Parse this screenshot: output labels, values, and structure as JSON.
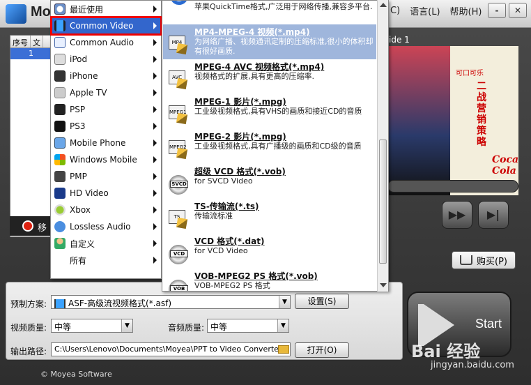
{
  "app": {
    "title": "Mo",
    "menu_about": "C)",
    "menu_language": "语言(L)",
    "menu_help": "帮助(H)",
    "btn_min": "-",
    "btn_close": "✕"
  },
  "list": {
    "col_seq": "序号",
    "col_file": "文",
    "row_seq": "1"
  },
  "preview": {
    "slide_label": "ide 1",
    "brand": "可口可乐",
    "slogan": "二战营销策略",
    "logo": "Coca-Cola"
  },
  "status": {
    "text": "移"
  },
  "buy_button": "购买(P)",
  "menu_main": {
    "items": [
      {
        "label": "最近使用",
        "icon": "clock-icon"
      },
      {
        "label": "Common Video",
        "icon": "film-icon"
      },
      {
        "label": "Common Audio",
        "icon": "note-icon"
      },
      {
        "label": "iPod",
        "icon": "ipod-icon"
      },
      {
        "label": "iPhone",
        "icon": "iphone-icon"
      },
      {
        "label": "Apple TV",
        "icon": "appletv-icon"
      },
      {
        "label": "PSP",
        "icon": "psp-icon"
      },
      {
        "label": "PS3",
        "icon": "ps3-icon"
      },
      {
        "label": "Mobile Phone",
        "icon": "phone-icon"
      },
      {
        "label": "Windows Mobile",
        "icon": "windows-icon"
      },
      {
        "label": "PMP",
        "icon": "pmp-icon"
      },
      {
        "label": "HD Video",
        "icon": "hd-icon"
      },
      {
        "label": "Xbox",
        "icon": "xbox-icon"
      },
      {
        "label": "Lossless Audio",
        "icon": "lossless-icon"
      },
      {
        "label": "自定义",
        "icon": "user-icon"
      },
      {
        "label": "所有",
        "icon": "all-icon"
      }
    ]
  },
  "menu_formats": {
    "top_desc": "苹果QuickTime格式,广泛用于网络传播,兼容多平台.",
    "items": [
      {
        "title": "MP4-MPEG-4 视频(*.mp4)",
        "desc": "为网络广播、视频通讯定制的压缩标准,很小的体积却有很好画质.",
        "icon": "MP4"
      },
      {
        "title": "MPEG-4 AVC 视频格式(*.mp4)",
        "desc": "视频格式的扩展,具有更高的压缩率.",
        "icon": "AVC"
      },
      {
        "title": "MPEG-1 影片(*.mpg)",
        "desc": "工业级视频格式,具有VHS的画质和接近CD的音质",
        "icon": "MPEG1"
      },
      {
        "title": "MPEG-2 影片(*.mpg)",
        "desc": "工业级视频格式,具有广播级的画质和CD级的音质",
        "icon": "MPEG2"
      },
      {
        "title": "超级 VCD 格式(*.vob)",
        "desc": "for SVCD Video",
        "icon": "SVCD"
      },
      {
        "title": "TS-传输流(*.ts)",
        "desc": "传输流标准",
        "icon": "TS"
      },
      {
        "title": "VCD 格式(*.dat)",
        "desc": "for VCD Video",
        "icon": "VCD"
      },
      {
        "title": "VOB-MPEG2 PS 格式(*.vob)",
        "desc": "VOB-MPEG2 PS 格式",
        "icon": "VOB"
      }
    ]
  },
  "settings": {
    "preset_label": "预制方案:",
    "preset_value": "ASF-高级流视频格式(*.asf)",
    "settings_btn": "设置(S)",
    "video_quality_label": "视频质量:",
    "video_quality_value": "中等",
    "audio_quality_label": "音频质量:",
    "audio_quality_value": "中等",
    "output_label": "输出路径:",
    "output_value": "C:\\Users\\Lenovo\\Documents\\Moyea\\PPT to Video Converter",
    "open_btn": "打开(O)"
  },
  "start_button": "Start",
  "footer": "© Moyea Software",
  "watermark": "Bai 经验",
  "watermark_url": "jingyan.baidu.com"
}
